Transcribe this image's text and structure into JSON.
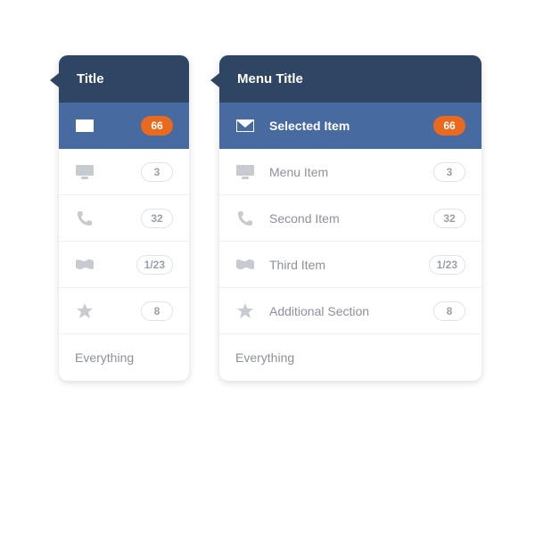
{
  "colors": {
    "header": "#2f4564",
    "selected": "#476ba0",
    "accent": "#e96a1f",
    "muted": "#8b919b"
  },
  "narrow": {
    "title": "Title",
    "items": [
      {
        "icon": "mail",
        "badge": "66",
        "selected": true
      },
      {
        "icon": "monitor",
        "badge": "3"
      },
      {
        "icon": "phone",
        "badge": "32"
      },
      {
        "icon": "flag",
        "badge": "1/23"
      },
      {
        "icon": "star",
        "badge": "8"
      }
    ],
    "footer": "Everything"
  },
  "wide": {
    "title": "Menu Title",
    "items": [
      {
        "icon": "mail",
        "label": "Selected Item",
        "badge": "66",
        "selected": true
      },
      {
        "icon": "monitor",
        "label": "Menu Item",
        "badge": "3"
      },
      {
        "icon": "phone",
        "label": "Second Item",
        "badge": "32"
      },
      {
        "icon": "flag",
        "label": "Third Item",
        "badge": "1/23"
      },
      {
        "icon": "star",
        "label": "Additional Section",
        "badge": "8"
      }
    ],
    "footer": "Everything"
  }
}
